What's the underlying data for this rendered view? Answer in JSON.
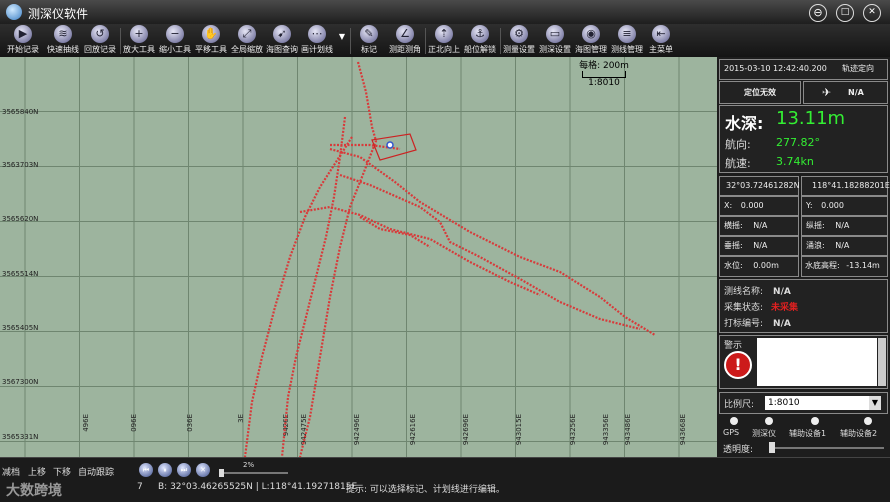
{
  "window": {
    "title": "测深仪软件",
    "minimize": "⊖",
    "maximize": "□",
    "close": "✕"
  },
  "toolbar": [
    {
      "label": "开始记录",
      "glyph": "▶"
    },
    {
      "label": "快速抽线",
      "glyph": "≋"
    },
    {
      "label": "回放记录",
      "glyph": "↺"
    },
    {
      "label": "放大工具",
      "glyph": "+"
    },
    {
      "label": "缩小工具",
      "glyph": "−"
    },
    {
      "label": "平移工具",
      "glyph": "✋"
    },
    {
      "label": "全局缩放",
      "glyph": "⤢"
    },
    {
      "label": "海图查询",
      "glyph": "➹"
    },
    {
      "label": "画计划线",
      "glyph": "⋯"
    },
    {
      "label": "标记",
      "glyph": "✎"
    },
    {
      "label": "测距测角",
      "glyph": "∠"
    },
    {
      "label": "正北向上",
      "glyph": "⇡"
    },
    {
      "label": "船位解锁",
      "glyph": "⚓"
    },
    {
      "label": "测量设置",
      "glyph": "⚙"
    },
    {
      "label": "测深设置",
      "glyph": "▭"
    },
    {
      "label": "海图管理",
      "glyph": "◉"
    },
    {
      "label": "测线管理",
      "glyph": "≡"
    },
    {
      "label": "主菜单",
      "glyph": "⇤"
    }
  ],
  "map": {
    "y_labels": [
      "3565840N",
      "3563703N",
      "3565620N",
      "3565514N",
      "3565405N",
      "3567300N",
      "3565331N"
    ],
    "x_labels": [
      "496E",
      "096E",
      "036E",
      "3E",
      "9426E",
      "942475E",
      "942496E",
      "942616E",
      "942696E",
      "943015E",
      "943256E",
      "943356E",
      "943486E",
      "943668E"
    ],
    "scale_label": "每格: 200m",
    "scale_ratio": "1:8010"
  },
  "panel": {
    "datetime": "2015-03-10 12:42:40.200",
    "track_mode": "轨迹定向",
    "fix_status": "定位无效",
    "sat_value": "N/A",
    "depth_label": "水深:",
    "depth_value": "13.11m",
    "heading_label": "航向:",
    "heading_value": "277.82°",
    "speed_label": "航速:",
    "speed_value": "3.74kn",
    "lat": "32°03.72461282N",
    "lon": "118°41.18288201E",
    "x_label": "X:",
    "x_value": "0.000",
    "y_label": "Y:",
    "y_value": "0.000",
    "roll_label": "横摇:",
    "roll_value": "N/A",
    "pitch_label": "纵摇:",
    "pitch_value": "N/A",
    "heave_label": "垂摇:",
    "heave_value": "N/A",
    "tide_label": "涌浪:",
    "tide_value": "N/A",
    "water_label": "水位:",
    "water_value": "0.00m",
    "bottom_label": "水底高程:",
    "bottom_value": "-13.14m",
    "line_name_label": "测线名称:",
    "line_name_value": "N/A",
    "acq_label": "采集状态:",
    "acq_value": "未采集",
    "mark_label": "打标编号:",
    "mark_value": "N/A",
    "warning_label": "警示",
    "scale_label": "比例尺:",
    "scale_value": "1:8010",
    "devices": [
      "GPS",
      "测深仪",
      "辅助设备1",
      "辅助设备2"
    ],
    "opacity_label": "透明度:"
  },
  "status": {
    "nav": [
      "减档",
      "上移",
      "下移",
      "自动跟踪"
    ],
    "zoom_pct": "2%",
    "field_num": "7",
    "coords": "B: 32°03.46265525N | L:118°41.19271815E",
    "hint": "提示:  可以选择标记、计划线进行编辑。",
    "watermark": "大数跨境"
  },
  "colors": {
    "depth": "#33ee33",
    "track": "#d83a3a",
    "warning": "#cc1a1a",
    "grid_bg": "#9db49e"
  }
}
